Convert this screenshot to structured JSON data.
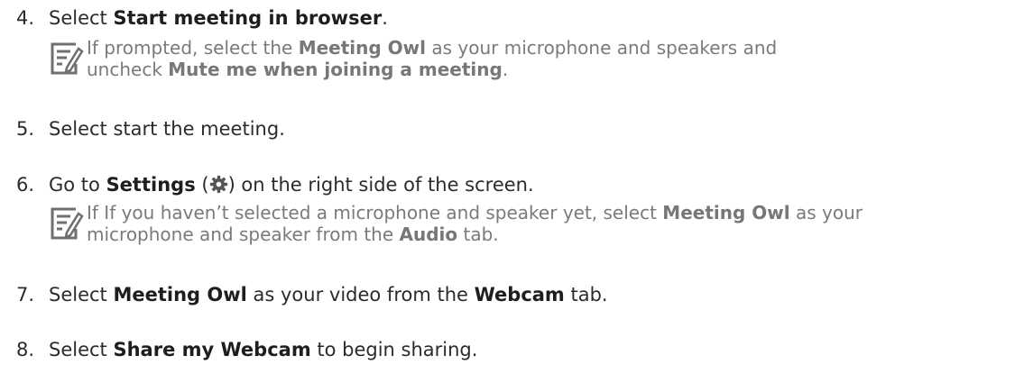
{
  "steps": [
    {
      "number": "4.",
      "parts": [
        "Select ",
        "Start meeting in browser",
        "."
      ],
      "note": {
        "line1": [
          "If prompted, select the ",
          "Meeting Owl",
          " as your microphone and speakers and"
        ],
        "line2": [
          "uncheck ",
          "Mute me when joining a meeting",
          "."
        ]
      }
    },
    {
      "number": "5.",
      "text": "Select start the meeting."
    },
    {
      "number": "6.",
      "parts": [
        "Go to ",
        "Settings",
        " (",
        ") on the right side of the screen."
      ],
      "icon": "gear-icon",
      "note": {
        "line1": [
          "If If you haven’t selected a microphone and speaker yet, select ",
          "Meeting Owl",
          " as your"
        ],
        "line2": [
          "microphone and speaker from the ",
          "Audio",
          " tab."
        ]
      }
    },
    {
      "number": "7.",
      "parts": [
        "Select ",
        "Meeting Owl",
        " as your video from the ",
        "Webcam",
        " tab."
      ]
    },
    {
      "number": "8.",
      "parts": [
        "Select ",
        "Share my Webcam",
        " to begin sharing."
      ]
    }
  ],
  "colors": {
    "text": "#2b2b2b",
    "note_text": "#7a7a7a",
    "icon": "#6f6f6f"
  }
}
